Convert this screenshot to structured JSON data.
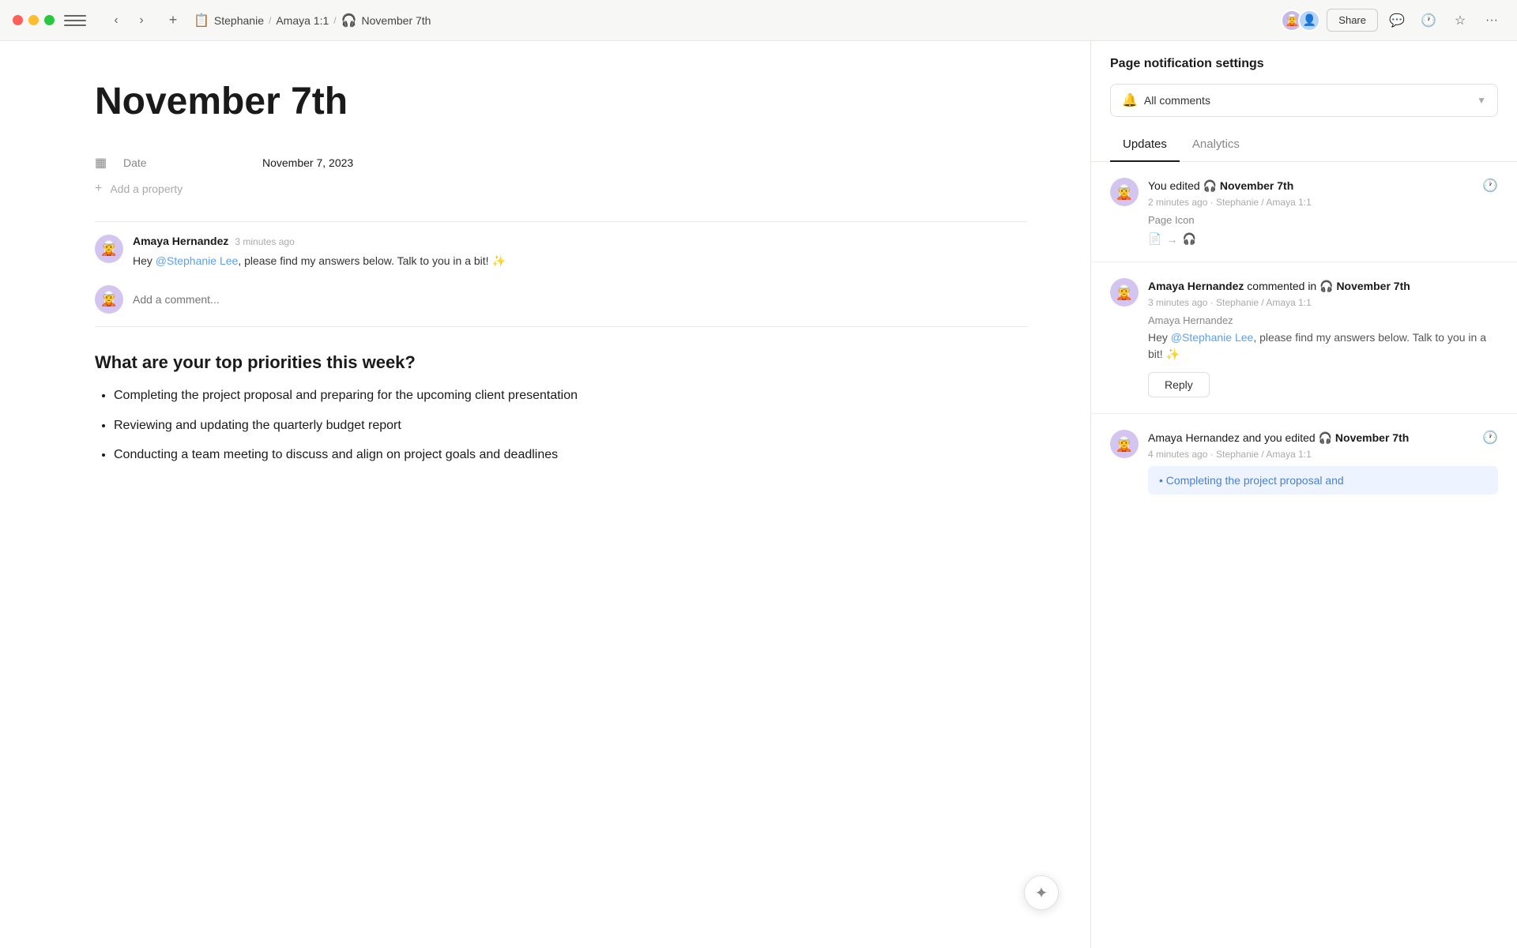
{
  "titlebar": {
    "breadcrumb_icon": "📋",
    "breadcrumb_workspace": "Stephanie",
    "breadcrumb_sep1": "/",
    "breadcrumb_notebook": "Amaya 1:1",
    "breadcrumb_sep2": "/",
    "breadcrumb_page_icon": "🎧",
    "breadcrumb_page": "November 7th",
    "share_label": "Share",
    "add_btn": "+",
    "nav_back": "‹",
    "nav_fwd": "›"
  },
  "page": {
    "title": "November 7th",
    "properties": [
      {
        "icon": "▦",
        "label": "Date",
        "value": "November 7, 2023"
      }
    ],
    "add_property_label": "Add a property",
    "comments": [
      {
        "author": "Amaya Hernandez",
        "time": "3 minutes ago",
        "avatar_emoji": "🧝",
        "text_plain": "Hey ",
        "mention": "@Stephanie Lee",
        "text_after": ", please find my answers below. Talk to you in a bit! ✨"
      }
    ],
    "comment_placeholder": "Add a comment...",
    "section_heading": "What are your top priorities this week?",
    "bullets": [
      "Completing the project proposal and preparing for the upcoming client presentation",
      "Reviewing and updating the quarterly budget report",
      "Conducting a team meeting to discuss and align on project goals and deadlines"
    ]
  },
  "right_panel": {
    "title": "Page notification settings",
    "notification_option": "All comments",
    "tabs": [
      {
        "id": "updates",
        "label": "Updates",
        "active": true
      },
      {
        "id": "analytics",
        "label": "Analytics",
        "active": false
      }
    ],
    "activities": [
      {
        "id": "edit1",
        "type": "edit",
        "avatar_emoji": "🧝",
        "title_prefix": "You edited",
        "page_icon": "🎧",
        "page_name": "November 7th",
        "subtitle": "2 minutes ago · Stephanie / Amaya 1:1",
        "detail_type": "icon_change",
        "detail_label": "Page Icon",
        "icon_from": "📄",
        "icon_to": "🎧"
      },
      {
        "id": "comment1",
        "type": "comment",
        "avatar_emoji": "🧝",
        "author": "Amaya Hernandez",
        "action": "commented in",
        "page_icon": "🎧",
        "page_name": "November 7th",
        "subtitle": "3 minutes ago · Stephanie / Amaya 1:1",
        "commenter_name": "Amaya Hernandez",
        "comment_text_plain": "Hey ",
        "comment_mention": "@Stephanie Lee",
        "comment_text_after": ", please find my answers below. Talk to you in a bit! ✨",
        "reply_label": "Reply"
      },
      {
        "id": "edit2",
        "type": "edit_shared",
        "avatar_emoji": "🧝",
        "title": "Amaya Hernandez and you edited",
        "page_icon": "🎧",
        "page_name": "November 7th",
        "subtitle": "4 minutes ago · Stephanie / Amaya 1:1",
        "detail_type": "highlight",
        "highlight_text": "Completing the project proposal and"
      }
    ]
  }
}
